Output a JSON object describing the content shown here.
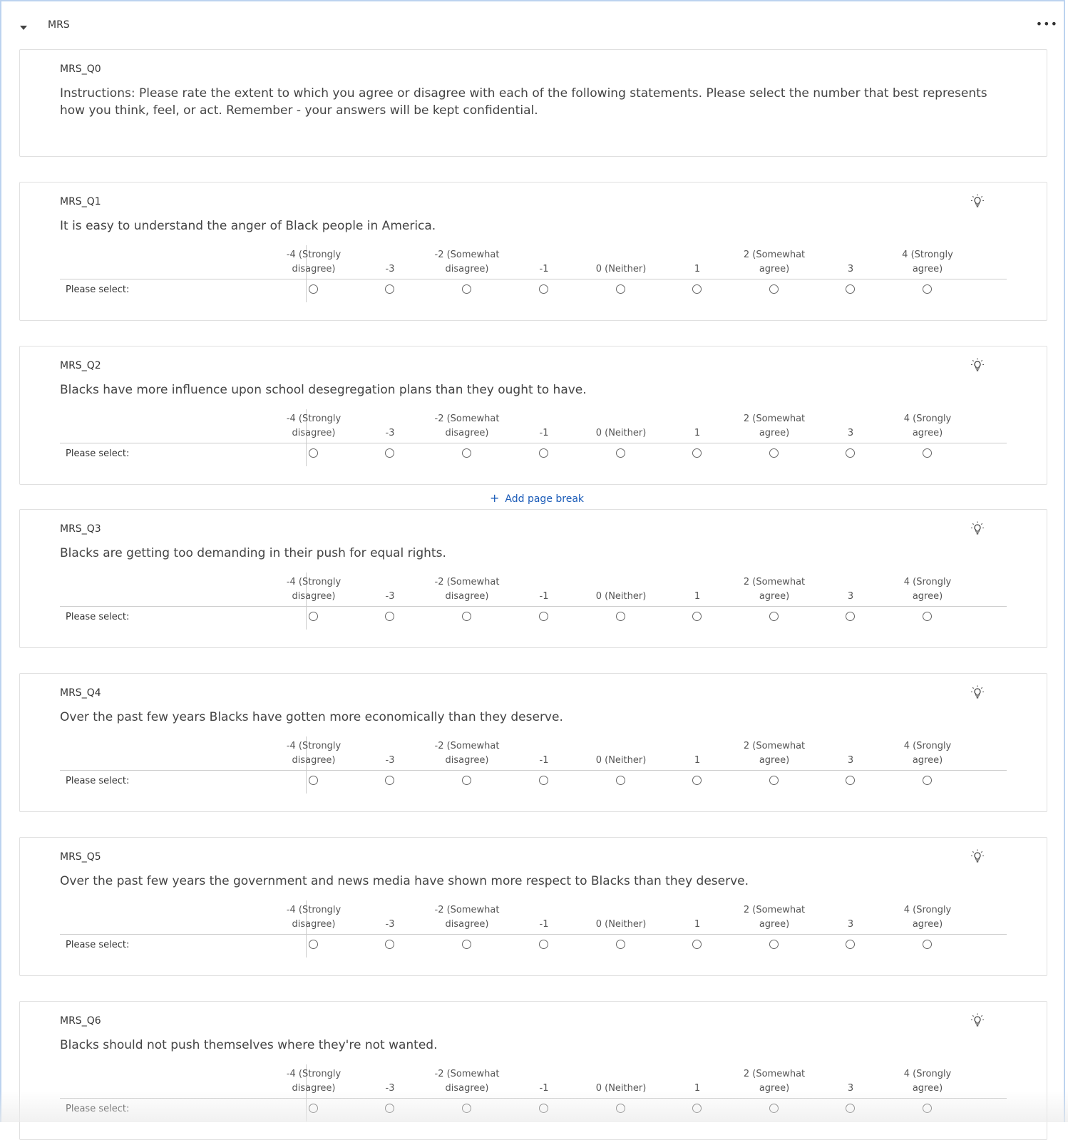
{
  "block": {
    "title": "MRS",
    "collapse_icon": "caret-down-icon",
    "more_icon": "ellipsis-icon"
  },
  "instructions": {
    "id": "MRS_Q0",
    "text": "Instructions: Please rate the extent to which you agree or disagree with each of the following statements. Please select the number that best represents how you think, feel, or act. Remember - your answers will be kept confidential."
  },
  "scale_headers": [
    "-4 (Strongly disagree)",
    "-3",
    "-2 (Somewhat disagree)",
    "-1",
    "0 (Neither)",
    "1",
    "2 (Somewhat agree)",
    "3",
    "4 (Srongly agree)"
  ],
  "q1_scale_last": "4 (Strongly agree)",
  "row_label": "Please select:",
  "page_break": "Add page break",
  "questions": [
    {
      "id": "MRS_Q1",
      "text": "It is easy to understand the anger of Black people in America."
    },
    {
      "id": "MRS_Q2",
      "text": "Blacks have more influence upon school desegregation plans than they ought to have."
    },
    {
      "id": "MRS_Q3",
      "text": "Blacks are getting too demanding in their push for equal rights."
    },
    {
      "id": "MRS_Q4",
      "text": "Over the past few years Blacks have gotten more economically than they deserve."
    },
    {
      "id": "MRS_Q5",
      "text": "Over the past few years the government and news media have shown more respect to Blacks than they deserve."
    },
    {
      "id": "MRS_Q6",
      "text": "Blacks should not push themselves where they're not wanted."
    }
  ]
}
